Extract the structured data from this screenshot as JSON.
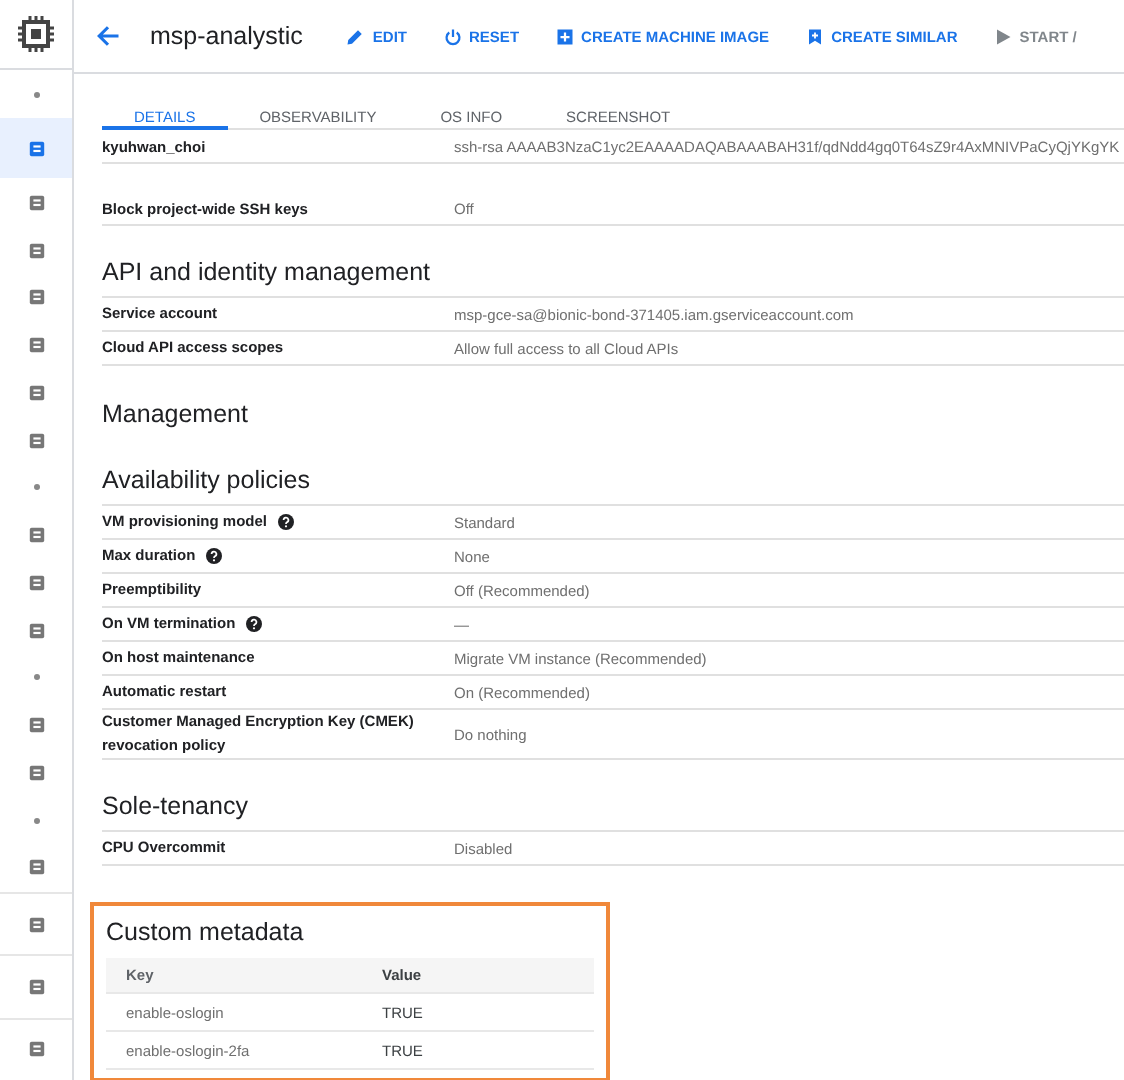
{
  "header": {
    "title": "msp-analystic",
    "actions": [
      {
        "label": "EDIT",
        "disabled": false
      },
      {
        "label": "RESET",
        "disabled": false
      },
      {
        "label": "CREATE MACHINE IMAGE",
        "disabled": false
      },
      {
        "label": "CREATE SIMILAR",
        "disabled": false
      },
      {
        "label": "START /",
        "disabled": true
      }
    ]
  },
  "sidebar": {
    "items": [
      {
        "kind": "dot",
        "selected": false
      },
      {
        "kind": "icon",
        "selected": true
      },
      {
        "kind": "icon",
        "selected": false
      },
      {
        "kind": "icon",
        "selected": false
      },
      {
        "kind": "icon",
        "selected": false
      },
      {
        "kind": "icon",
        "selected": false
      },
      {
        "kind": "icon",
        "selected": false
      },
      {
        "kind": "icon",
        "selected": false
      },
      {
        "kind": "dot",
        "selected": false
      },
      {
        "kind": "icon",
        "selected": false
      },
      {
        "kind": "icon",
        "selected": false
      },
      {
        "kind": "icon",
        "selected": false
      },
      {
        "kind": "dot",
        "selected": false
      },
      {
        "kind": "icon",
        "selected": false
      },
      {
        "kind": "icon",
        "selected": false
      },
      {
        "kind": "dot",
        "selected": false
      },
      {
        "kind": "icon",
        "selected": false
      },
      {
        "kind": "separated",
        "selected": false
      },
      {
        "kind": "separated",
        "selected": false
      },
      {
        "kind": "separated",
        "selected": false
      }
    ]
  },
  "tabs": [
    {
      "label": "DETAILS",
      "selected": true
    },
    {
      "label": "OBSERVABILITY",
      "selected": false
    },
    {
      "label": "OS INFO",
      "selected": false
    },
    {
      "label": "SCREENSHOT",
      "selected": false
    }
  ],
  "blocks": [
    {
      "kind": "clipped",
      "label": "kyuhwan_choi",
      "value": "ssh-rsa AAAAB3NzaC1yc2EAAAADAQABAAABAH31f/qdNdd4gq0T64sZ9r4AxMNIVPaCyQjYKgYK"
    },
    {
      "kind": "rows",
      "rows": [
        {
          "label": "Block project-wide SSH keys",
          "value": "Off",
          "help": false
        }
      ]
    },
    {
      "kind": "section",
      "title": "API and identity management",
      "rows": [
        {
          "label": "Service account",
          "value": "msp-gce-sa@bionic-bond-371405.iam.gserviceaccount.com",
          "help": false
        },
        {
          "label": "Cloud API access scopes",
          "value": "Allow full access to all Cloud APIs",
          "help": false
        }
      ]
    },
    {
      "kind": "heading",
      "title": "Management"
    },
    {
      "kind": "section",
      "title": "Availability policies",
      "rows": [
        {
          "label": "VM provisioning model",
          "value": "Standard",
          "help": true
        },
        {
          "label": "Max duration",
          "value": "None",
          "help": true
        },
        {
          "label": "Preemptibility",
          "value": "Off (Recommended)",
          "help": false
        },
        {
          "label": "On VM termination",
          "value": "—",
          "help": true
        },
        {
          "label": "On host maintenance",
          "value": "Migrate VM instance (Recommended)",
          "help": false
        },
        {
          "label": "Automatic restart",
          "value": "On (Recommended)",
          "help": false
        },
        {
          "label": "Customer Managed Encryption Key (CMEK) revocation policy",
          "value": "Do nothing",
          "help": false
        }
      ]
    },
    {
      "kind": "section",
      "title": "Sole-tenancy",
      "rows": [
        {
          "label": "CPU Overcommit",
          "value": "Disabled",
          "help": false
        }
      ]
    },
    {
      "kind": "metadata",
      "title": "Custom metadata",
      "columns": [
        "Key",
        "Value"
      ],
      "rows": [
        [
          "enable-oslogin",
          "TRUE"
        ],
        [
          "enable-oslogin-2fa",
          "TRUE"
        ]
      ]
    }
  ]
}
